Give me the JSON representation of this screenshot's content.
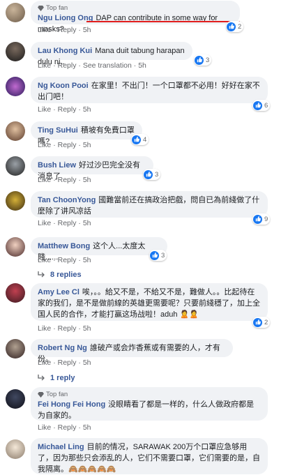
{
  "colors": {
    "link": "#385898",
    "like_blue": "#1877f2",
    "bubble": "#f0f2f5",
    "highlight": "#e11d1d"
  },
  "actions": {
    "like": "Like",
    "reply": "Reply",
    "see_translation": "See translation",
    "sep": "·"
  },
  "comments": [
    {
      "badge": "Top fan",
      "name": "Ngu Liong Ong",
      "text": "DAP can contribute in some way for masks?",
      "reactions": "2",
      "time": "5h"
    },
    {
      "name": "Lau Khong Kui",
      "text": "Mana duit tabung harapan dulu ni..",
      "reactions": "3",
      "time": "5h"
    },
    {
      "name": "Ng Koon Pooi",
      "text": "在家里！不出门！一个口罩都不必用！好好在家不出门吧！",
      "reactions": "6",
      "time": "5h"
    },
    {
      "name": "Ting SuHui",
      "text": "積坡有免費口罩嗎?",
      "reactions": "4",
      "time": "5h"
    },
    {
      "name": "Bush Liew",
      "text": "好过沙巴完全没有消息了",
      "reactions": "3",
      "time": "5h"
    },
    {
      "name": "Tan ChoonYong",
      "text": "國難當前还在搞政治把戲，問自已為前綫做了什麼除了讲风凉話",
      "reactions": "9",
      "time": "5h"
    },
    {
      "name": "Matthew Bong",
      "text": "这个人...太度太賤......",
      "reactions": "3",
      "time": "5h",
      "replies": "8 replies"
    },
    {
      "name": "Amy Lee Cl",
      "text": "唉，。。給又不是，不給又不是，難做人。。比起待在家的我们，是不是做前線的英雄更需要呢？只要前綫穩了，加上全国人民的合作，才能打贏这场战啦！aduh 🙎🙎",
      "reactions": "2",
      "time": "5h"
    },
    {
      "name": "Robert Ng Ng",
      "text": "誰破产或会炸香蕉或有需要的人，才有份。",
      "time": "5h",
      "replies": "1 reply"
    },
    {
      "badge": "Top fan",
      "name": "Fei Hong Fei Hong",
      "text": "没眼睛看了都是一样的，什么人做政府都是为自家的。",
      "time": "5h"
    },
    {
      "name": "Michael Ling",
      "text": "目前的情况，SARAWAK 200万个口罩应急够用了，因为那些只会添乱的人，它们不需要口罩，它们需要的是，自我隔离。🙈🙈🙈🙈🙈"
    }
  ]
}
